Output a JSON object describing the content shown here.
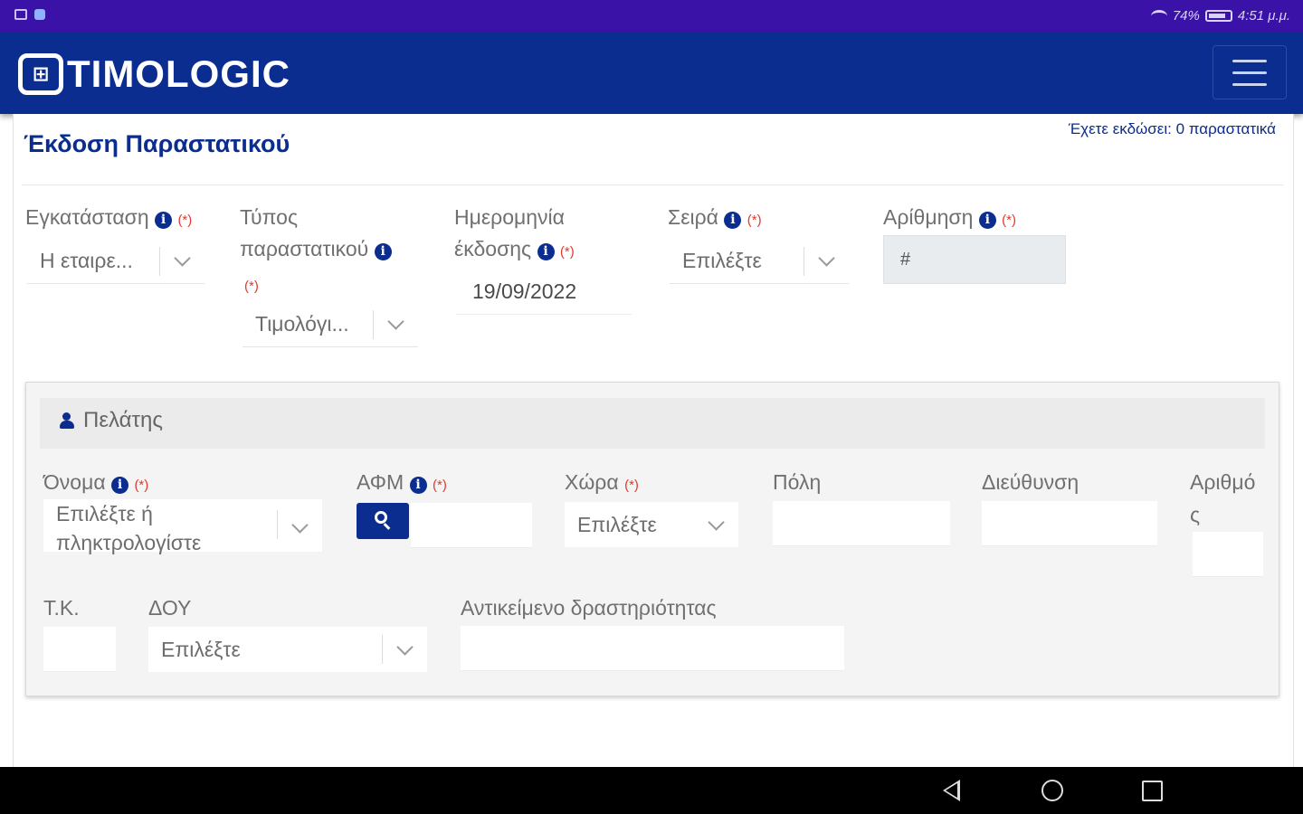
{
  "status_bar": {
    "battery": "74%",
    "time": "4:51 μ.μ."
  },
  "app": {
    "logo_text": "TIMOLOGIC"
  },
  "page": {
    "title": "Έκδοση Παραστατικού",
    "issued_text": "Έχετε εκδώσει: 0 παραστατικά"
  },
  "required_mark": "(*)",
  "info_glyph": "i",
  "form": {
    "installation": {
      "label": "Εγκατάσταση",
      "value": "Η εταιρε..."
    },
    "doc_type": {
      "label_line1": "Τύπος",
      "label_line2": "παραστατικού",
      "value": "Τιμολόγι..."
    },
    "issue_date": {
      "label_line1": "Ημερομηνία",
      "label_line2": "έκδοσης",
      "value": "19/09/2022"
    },
    "series": {
      "label": "Σειρά",
      "value": "Επιλέξτε"
    },
    "numbering": {
      "label": "Αρίθμηση",
      "value": "#"
    }
  },
  "customer": {
    "title": "Πελάτης",
    "name": {
      "label": "Όνομα",
      "placeholder_line1": "Επιλέξτε ή",
      "placeholder_line2": "πληκτρολογίστε"
    },
    "afm": {
      "label": "ΑΦΜ"
    },
    "country": {
      "label": "Χώρα",
      "value": "Επιλέξτε"
    },
    "city": {
      "label": "Πόλη"
    },
    "address": {
      "label": "Διεύθυνση"
    },
    "number": {
      "label_line1": "Αριθμό",
      "label_line2": "ς"
    },
    "zip": {
      "label": "Τ.Κ."
    },
    "doy": {
      "label": "ΔΟΥ",
      "value": "Επιλέξτε"
    },
    "activity": {
      "label": "Αντικείμενο δραστηριότητας"
    }
  },
  "colors": {
    "status_bar": "#3a12a8",
    "brand": "#0a2d8f",
    "required": "#e0392e"
  }
}
